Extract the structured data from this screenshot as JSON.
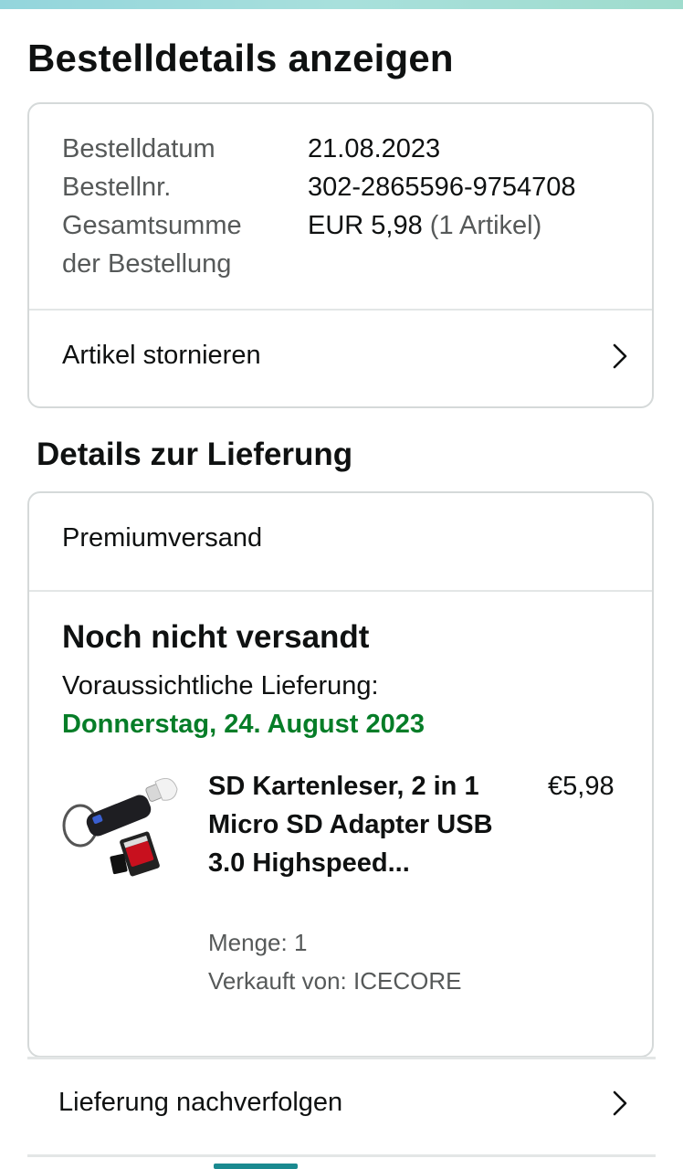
{
  "page_title": "Bestelldetails anzeigen",
  "order_summary": {
    "rows": [
      {
        "label": "Bestelldatum",
        "value": "21.08.2023"
      },
      {
        "label": "Bestellnr.",
        "value": "302-2865596-9754708"
      }
    ],
    "total_label_line1": "Gesamtsumme",
    "total_label_line2": "der Bestellung",
    "total_value": "EUR 5,98",
    "total_items": "(1 Artikel)",
    "cancel_label": "Artikel stornieren"
  },
  "delivery_section_title": "Details zur Lieferung",
  "delivery": {
    "shipping_method": "Premiumversand",
    "status": "Noch nicht versandt",
    "expected_label": "Voraussichtliche Lieferung:",
    "expected_date": "Donnerstag, 24. August 2023",
    "status_color": "#067d28"
  },
  "item": {
    "title": "SD Kartenleser, 2 in 1 Micro SD Adapter USB 3.0 Highspeed...",
    "price": "€5,98",
    "quantity": "Menge: 1",
    "seller": "Verkauft von: ICECORE"
  },
  "track_label": "Lieferung nachverfolgen"
}
